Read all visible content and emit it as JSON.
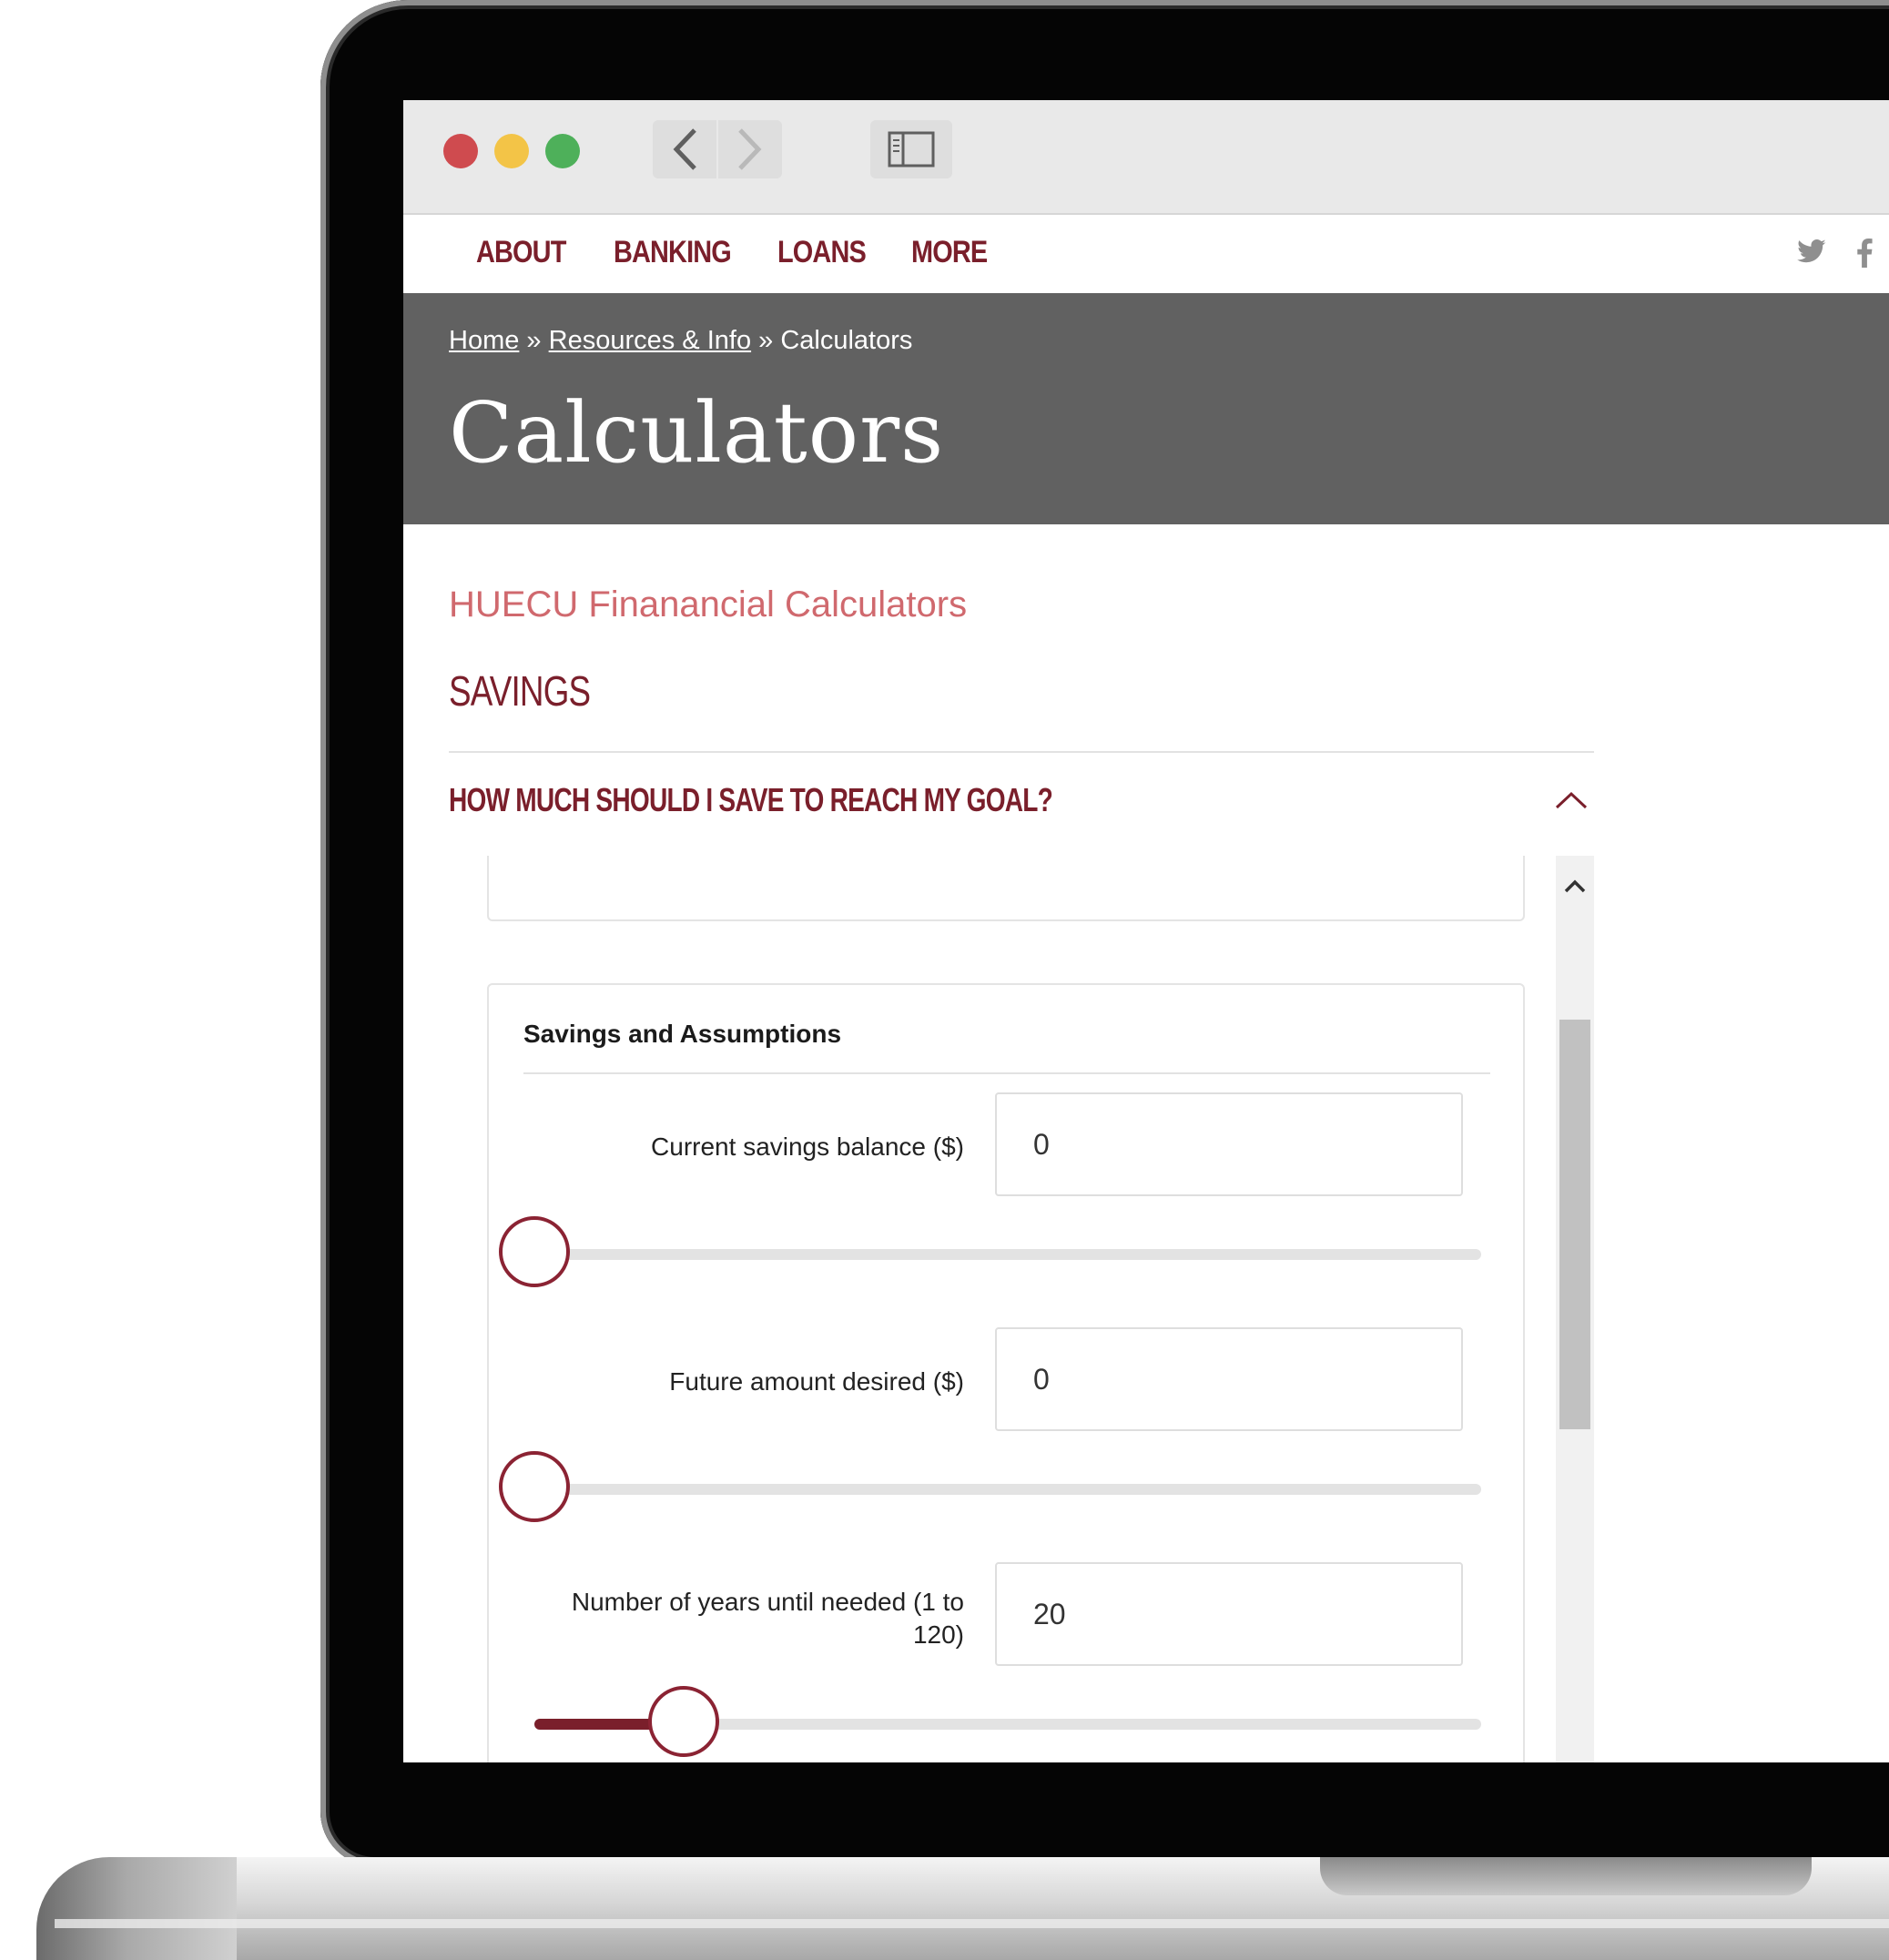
{
  "nav": {
    "items": [
      "ABOUT",
      "BANKING",
      "LOANS",
      "MORE"
    ]
  },
  "social": {
    "twitter": "twitter-icon",
    "facebook": "facebook-icon"
  },
  "breadcrumb": {
    "home": "Home",
    "sep": "»",
    "resources": "Resources & Info",
    "current": "Calculators"
  },
  "page": {
    "title": "Calculators",
    "subtitle": "HUECU Finanancial Calculators",
    "section": "SAVINGS"
  },
  "accordion": {
    "title": "HOW MUCH SHOULD I SAVE TO REACH MY GOAL?",
    "expanded": true
  },
  "calculator": {
    "card_title": "Savings and Assumptions",
    "fields": [
      {
        "label": "Current savings balance ($)",
        "value": "0",
        "slider_fraction": 0
      },
      {
        "label": "Future amount desired ($)",
        "value": "0",
        "slider_fraction": 0
      },
      {
        "label_line1": "Number of years until needed (1 to",
        "label_line2": "120)",
        "value": "20",
        "slider_fraction": 0.158
      }
    ]
  },
  "colors": {
    "brand": "#7a1f2b",
    "accent_light": "#d0696e",
    "hero_bg": "#616161"
  }
}
